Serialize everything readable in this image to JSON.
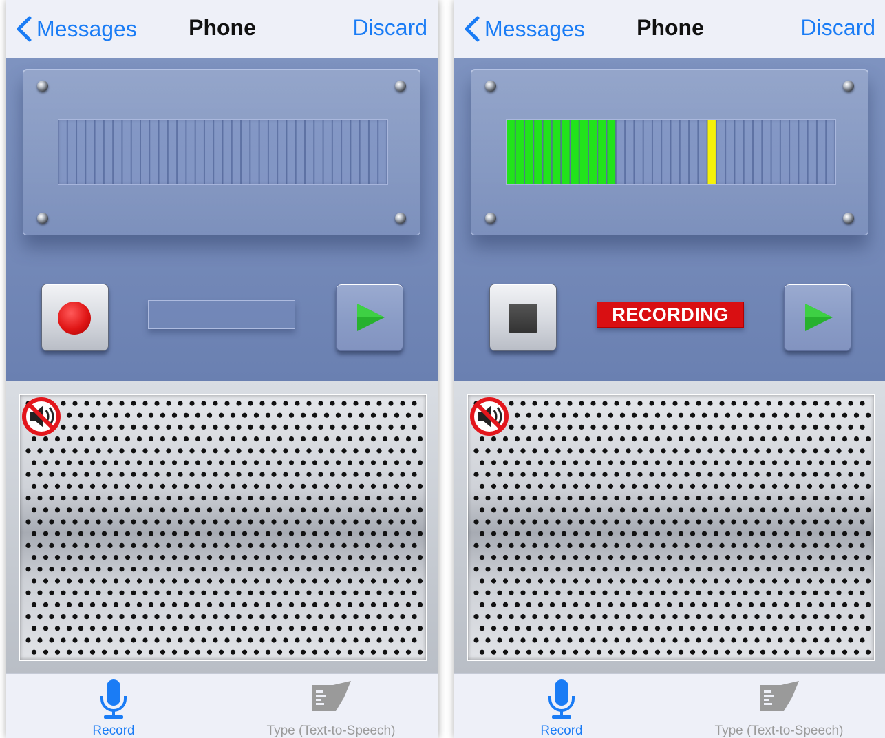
{
  "screens": [
    {
      "nav": {
        "back_label": "Messages",
        "title": "Phone",
        "action_label": "Discard"
      },
      "meter": {
        "level_segments": 0,
        "peak_segment": null,
        "total_segments": 36
      },
      "record_button": {
        "icon": "record-dot-icon"
      },
      "status_label": "",
      "play_button": {
        "icon": "play-icon"
      },
      "speaker": {
        "mute_icon": "speaker-muted-icon"
      },
      "tabs": [
        {
          "label": "Record",
          "icon": "microphone-icon",
          "selected": true
        },
        {
          "label": "Type (Text-to-Speech)",
          "icon": "text-to-speech-icon",
          "selected": false
        }
      ]
    },
    {
      "nav": {
        "back_label": "Messages",
        "title": "Phone",
        "action_label": "Discard"
      },
      "meter": {
        "level_segments": 12,
        "peak_segment": 22,
        "total_segments": 36
      },
      "record_button": {
        "icon": "stop-square-icon"
      },
      "status_label": "RECORDING",
      "play_button": {
        "icon": "play-icon"
      },
      "speaker": {
        "mute_icon": "speaker-muted-icon"
      },
      "tabs": [
        {
          "label": "Record",
          "icon": "microphone-icon",
          "selected": true
        },
        {
          "label": "Type (Text-to-Speech)",
          "icon": "text-to-speech-icon",
          "selected": false
        }
      ]
    }
  ],
  "colors": {
    "accent": "#1a7cf5",
    "panel_blue": "#7489b8",
    "meter_level": "#22e31b",
    "meter_peak": "#f5f10a",
    "recording_badge": "#d90f12",
    "tab_inactive": "#9b9b9b"
  }
}
